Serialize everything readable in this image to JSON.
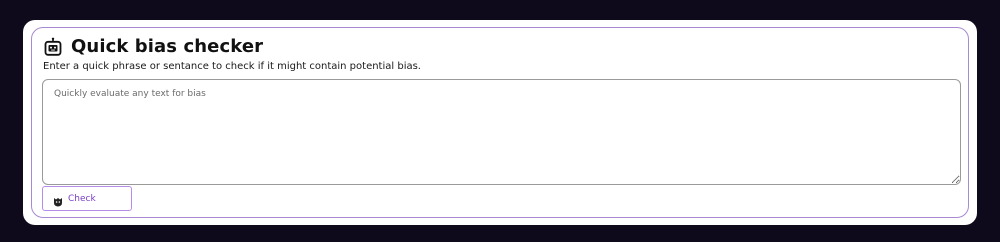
{
  "card": {
    "title": "Quick bias checker",
    "subtitle": "Enter a quick phrase or sentance to check if it might contain potential bias.",
    "header_icon": "robot-icon"
  },
  "input": {
    "placeholder": "Quickly evaluate any text for bias",
    "value": ""
  },
  "button": {
    "label": "Check",
    "icon": "badge-icon"
  },
  "colors": {
    "background": "#0e0a1c",
    "card": "#ffffff",
    "card_border": "#a78ad2",
    "accent": "#7a3fc4",
    "button_border": "#b58ce8"
  }
}
